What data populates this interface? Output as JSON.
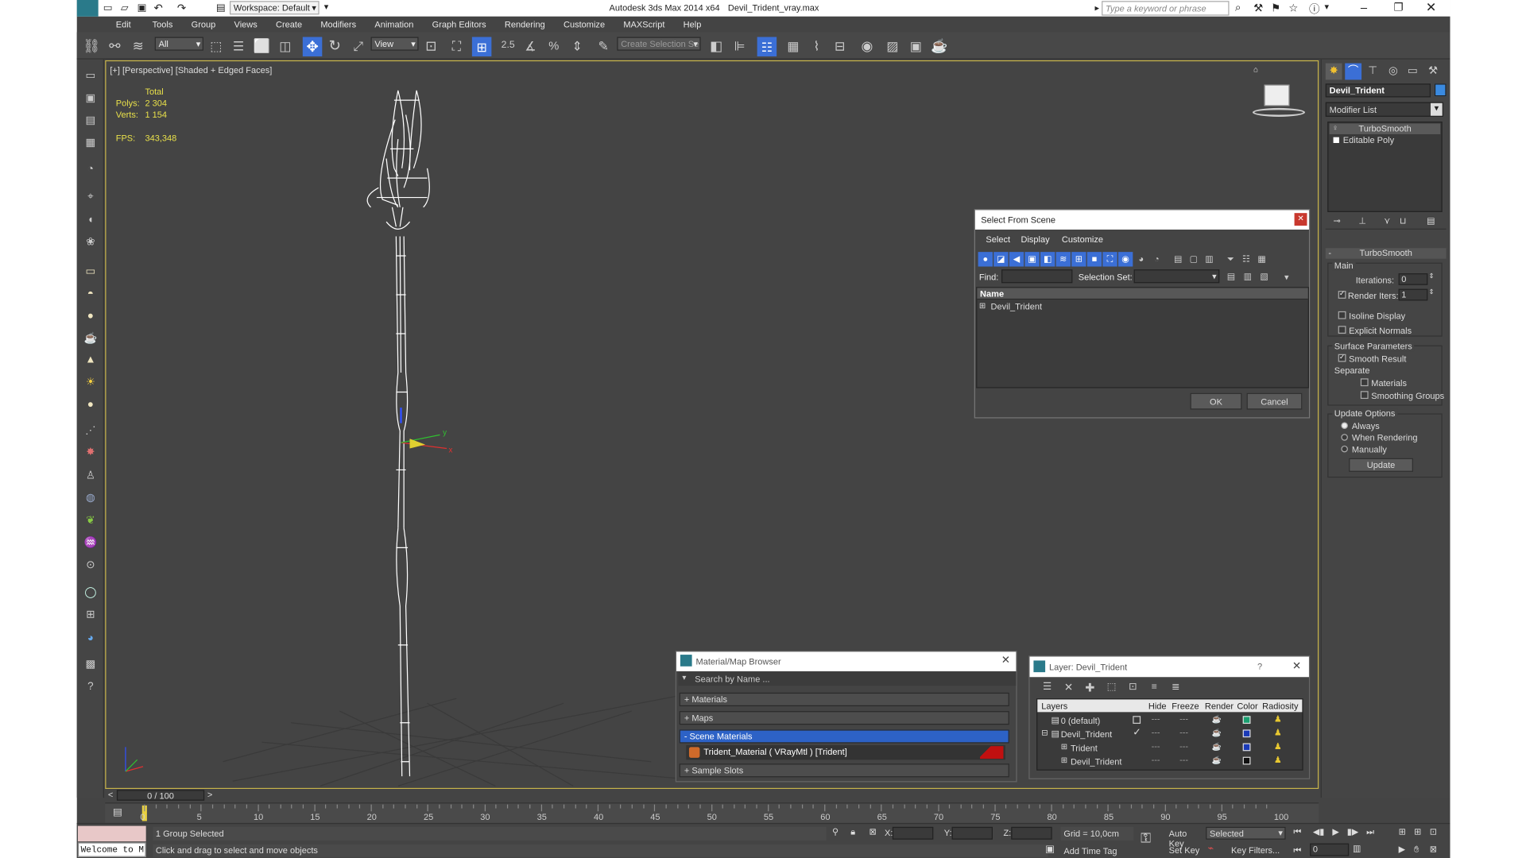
{
  "titlebar": {
    "app": "Autodesk 3ds Max  2014 x64",
    "file": "Devil_Trident_vray.max",
    "workspace": "Workspace: Default",
    "search_placeholder": "Type a keyword or phrase"
  },
  "menu": [
    "Edit",
    "Tools",
    "Group",
    "Views",
    "Create",
    "Modifiers",
    "Animation",
    "Graph Editors",
    "Rendering",
    "Customize",
    "MAXScript",
    "Help"
  ],
  "toolbar": {
    "filter": "All",
    "refcoord": "View",
    "selset_placeholder": "Create Selection Se"
  },
  "viewport": {
    "label": "[+] [Perspective] [Shaded + Edged Faces]",
    "stats": {
      "total": "Total",
      "polys_label": "Polys:",
      "polys": "2 304",
      "verts_label": "Verts:",
      "verts": "1 154",
      "fps_label": "FPS:",
      "fps": "343,348"
    },
    "axis_x": "x",
    "axis_y": "y"
  },
  "select_dialog": {
    "title": "Select From Scene",
    "menu": [
      "Select",
      "Display",
      "Customize"
    ],
    "find_label": "Find:",
    "selset_label": "Selection Set:",
    "col_name": "Name",
    "items": [
      "Devil_Trident"
    ],
    "ok": "OK",
    "cancel": "Cancel"
  },
  "material_browser": {
    "title": "Material/Map Browser",
    "search_placeholder": "Search by Name ...",
    "sections": [
      "+ Materials",
      "+ Maps",
      "- Scene Materials"
    ],
    "material_item": "Trident_Material  ( VRayMtl )  [Trident]",
    "sample_slots": "+ Sample Slots"
  },
  "layer_dialog": {
    "title": "Layer: Devil_Trident",
    "help": "?",
    "cols": [
      "Layers",
      "Hide",
      "Freeze",
      "Render",
      "Color",
      "Radiosity"
    ],
    "rows": [
      {
        "name": "0 (default)",
        "color": "#1aa070"
      },
      {
        "name": "Devil_Trident",
        "color": "#1a3ab8"
      },
      {
        "name": "Trident",
        "color": "#1a3ab8"
      },
      {
        "name": "Devil_Trident",
        "color": "#111111"
      }
    ]
  },
  "command_panel": {
    "object_name": "Devil_Trident",
    "modifier_list": "Modifier List",
    "stack": [
      "TurboSmooth",
      "Editable Poly"
    ],
    "rollout": "TurboSmooth",
    "main_label": "Main",
    "iterations_label": "Iterations:",
    "iterations": "0",
    "render_iters_label": "Render Iters:",
    "render_iters": "1",
    "isoline": "Isoline Display",
    "explicit": "Explicit Normals",
    "surface": "Surface Parameters",
    "smooth_result": "Smooth Result",
    "separate": "Separate",
    "materials": "Materials",
    "smoothing": "Smoothing Groups",
    "update_options": "Update Options",
    "always": "Always",
    "when_rendering": "When Rendering",
    "manually": "Manually",
    "update": "Update"
  },
  "timeline": {
    "frame": "0 / 100",
    "ticks": [
      "0",
      "5",
      "10",
      "15",
      "20",
      "25",
      "30",
      "35",
      "40",
      "45",
      "50",
      "55",
      "60",
      "65",
      "70",
      "75",
      "80",
      "85",
      "90",
      "95",
      "100"
    ]
  },
  "status": {
    "welcome": "Welcome to M",
    "selected": "1 Group Selected",
    "prompt": "Click and drag to select and move objects",
    "x_label": "X:",
    "y_label": "Y:",
    "z_label": "Z:",
    "grid": "Grid = 10,0cm",
    "add_time_tag": "Add Time Tag",
    "auto_key": "Auto Key",
    "set_key": "Set Key",
    "key_mode": "Selected",
    "key_filters": "Key Filters...",
    "frame_field": "0"
  }
}
